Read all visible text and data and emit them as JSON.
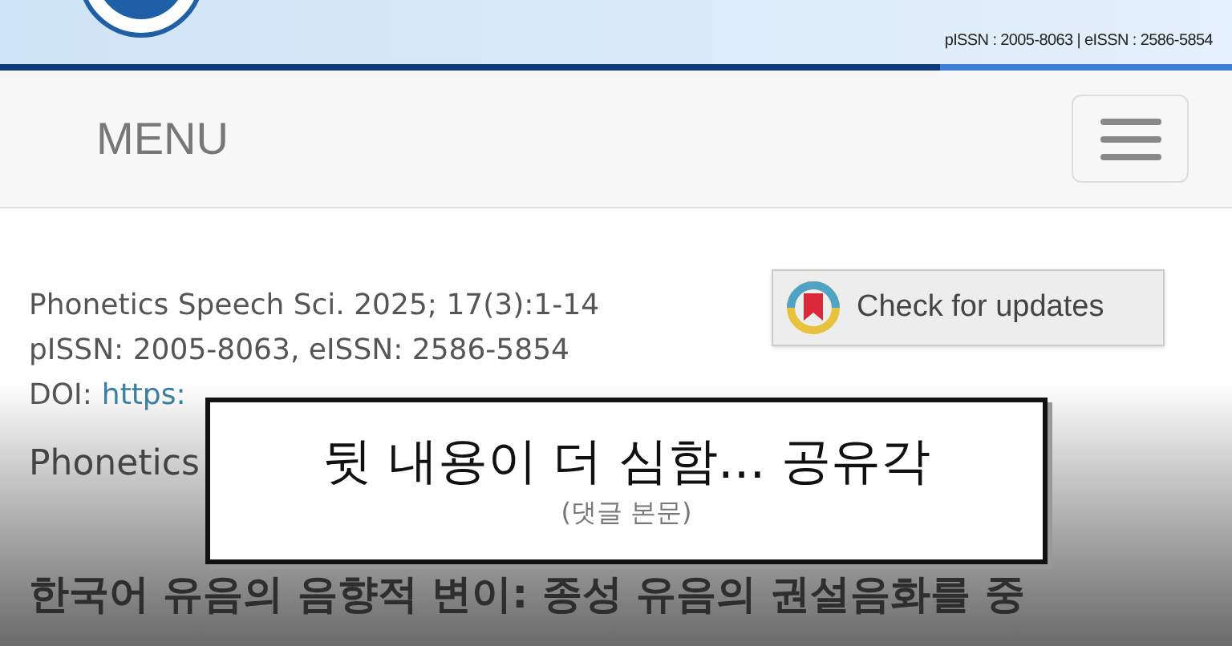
{
  "header": {
    "issn": "pISSN : 2005-8063 | eISSN : 2586-5854"
  },
  "nav": {
    "label": "MENU"
  },
  "citation": {
    "journal": "Phonetics Speech Sci. 2025; 17(3):1-14",
    "issn": "pISSN: 2005-8063, eISSN: 2586-5854",
    "doi_label": "DOI:",
    "doi_link": "https:"
  },
  "updates_button": {
    "label": "Check for updates"
  },
  "category": "Phonetics",
  "article_title": "한국어 유음의 음향적 변이: 종성 유음의 권설음화를 중",
  "caption": {
    "text": "뒷 내용이 더 심함... 공유각",
    "subtext": "(댓글 본문)"
  }
}
